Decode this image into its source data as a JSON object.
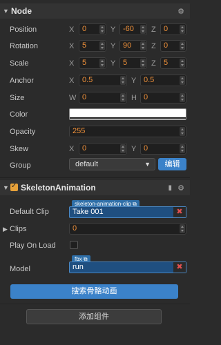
{
  "node": {
    "title": "Node",
    "position": {
      "label": "Position",
      "x": "0",
      "y": "-60",
      "z": "0"
    },
    "rotation": {
      "label": "Rotation",
      "x": "5",
      "y": "90",
      "z": "0"
    },
    "scale": {
      "label": "Scale",
      "x": "5",
      "y": "5",
      "z": "5"
    },
    "anchor": {
      "label": "Anchor",
      "x": "0.5",
      "y": "0.5"
    },
    "size": {
      "label": "Size",
      "w": "0",
      "h": "0"
    },
    "color": {
      "label": "Color",
      "value": "#ffffff"
    },
    "opacity": {
      "label": "Opacity",
      "value": "255"
    },
    "skew": {
      "label": "Skew",
      "x": "0",
      "y": "0"
    },
    "group": {
      "label": "Group",
      "value": "default",
      "edit_button": "编辑"
    },
    "axis_labels": {
      "x": "X",
      "y": "Y",
      "z": "Z",
      "w": "W",
      "h": "H"
    }
  },
  "skeleton": {
    "title": "SkeletonAnimation",
    "default_clip": {
      "label": "Default Clip",
      "tag": "skeleton-animation-clip",
      "value": "Take 001"
    },
    "clips": {
      "label": "Clips",
      "value": "0"
    },
    "play_on_load": {
      "label": "Play On Load"
    },
    "model": {
      "label": "Model",
      "tag": "fbx",
      "value": "run"
    },
    "search_button": "搜索骨骼动画"
  },
  "add_component_button": "添加组件",
  "colors": {
    "accent_orange": "#e8a23a",
    "number_text": "#f0913a",
    "button_blue": "#3b82c9",
    "clear_red": "#e05050"
  }
}
